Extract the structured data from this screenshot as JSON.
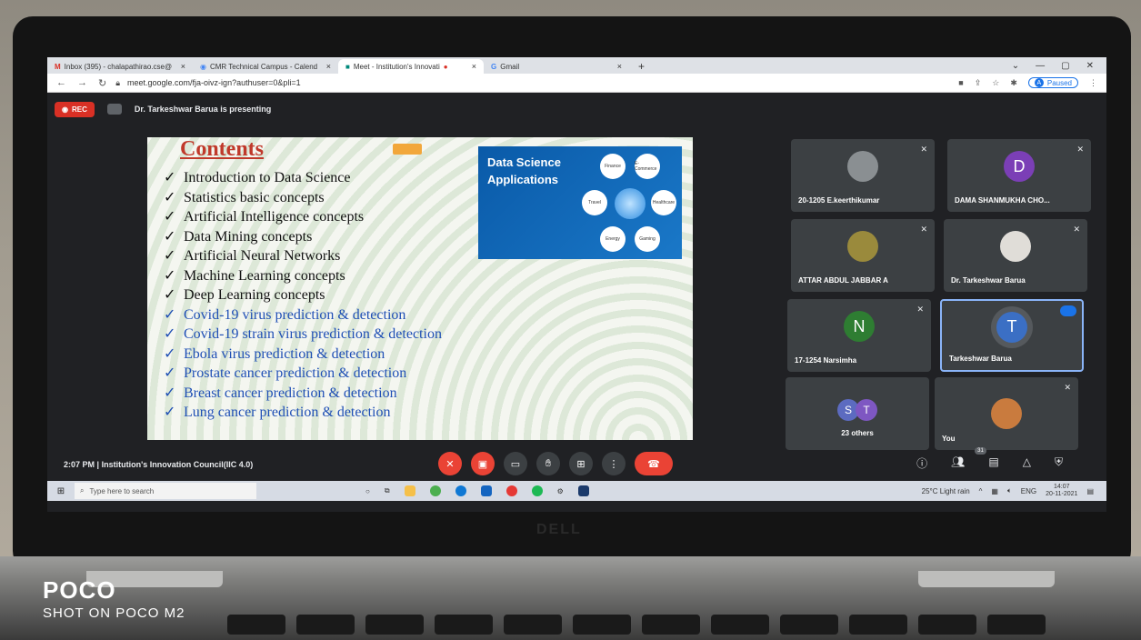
{
  "browser": {
    "tabs": [
      {
        "label": "Inbox (395) - chalapathirao.cse@",
        "icon": "gmail-icon"
      },
      {
        "label": "CMR Technical Campus - Calend",
        "icon": "chrome-icon"
      },
      {
        "label": "Meet - Institution's Innovati",
        "icon": "meet-icon"
      },
      {
        "label": "Gmail",
        "icon": "google-icon"
      }
    ],
    "new_tab": "+",
    "url": "meet.google.com/fja-oivz-ign?authuser=0&pli=1",
    "profile_initial": "A",
    "profile_status": "Paused"
  },
  "meet": {
    "rec_label": "REC",
    "presenting_text": "Dr. Tarkeshwar Barua is presenting",
    "time": "2:07 PM",
    "separator": "|",
    "meeting_name": "Institution's Innovation Council(IIC 4.0)",
    "participants_count": "31"
  },
  "slide": {
    "title": "Contents",
    "items": [
      {
        "text": "Introduction to Data Science",
        "color": "#111111"
      },
      {
        "text": "Statistics basic concepts",
        "color": "#111111"
      },
      {
        "text": "Artificial Intelligence concepts",
        "color": "#111111"
      },
      {
        "text": "Data Mining concepts",
        "color": "#111111"
      },
      {
        "text": "Artificial Neural Networks",
        "color": "#111111"
      },
      {
        "text": "Machine Learning concepts",
        "color": "#111111"
      },
      {
        "text": "Deep Learning concepts",
        "color": "#111111"
      },
      {
        "text": "Covid-19 virus prediction & detection",
        "color": "#1f4fb5"
      },
      {
        "text": "Covid-19 strain virus prediction & detection",
        "color": "#1f4fb5"
      },
      {
        "text": "Ebola virus prediction & detection",
        "color": "#1f4fb5"
      },
      {
        "text": "Prostate cancer prediction & detection",
        "color": "#1f4fb5"
      },
      {
        "text": "Breast cancer prediction & detection",
        "color": "#1f4fb5"
      },
      {
        "text": "Lung cancer prediction & detection",
        "color": "#1f4fb5"
      }
    ],
    "check": "✓",
    "apps_image_title_line1": "Data Science",
    "apps_image_title_line2": "Applications",
    "apps_hex_labels": [
      "Finance",
      "E-Commerce",
      "Healthcare",
      "Gaming",
      "Energy",
      "Travel"
    ]
  },
  "participants": [
    {
      "name": "20-1205 E.keerthikumar",
      "avatar": "photo",
      "muted": true
    },
    {
      "name": "DAMA SHANMUKHA CHO...",
      "avatar": "D",
      "avatar_color": "#7b3fb6",
      "muted": true
    },
    {
      "name": "ATTAR ABDUL JABBAR A",
      "avatar": "photo",
      "muted": true
    },
    {
      "name": "Dr. Tarkeshwar Barua",
      "avatar": "photo",
      "muted": true
    },
    {
      "name": "17-1254 Narsimha",
      "avatar": "N",
      "avatar_color": "#2e7d32",
      "muted": true
    },
    {
      "name": "Tarkeshwar Barua",
      "avatar": "T",
      "avatar_color": "#3b6fc4",
      "speaking": true
    },
    {
      "name": "23 others",
      "avatar_letters": [
        "S",
        "T"
      ],
      "avatar_colors": [
        "#5c6bc0",
        "#7e57c2"
      ]
    },
    {
      "name": "You",
      "avatar": "photo",
      "muted": true
    }
  ],
  "taskbar": {
    "search_placeholder": "Type here to search",
    "weather": "25°C  Light rain",
    "language": "ENG",
    "clock_time": "14:07",
    "clock_date": "20-11-2021"
  },
  "photo_overlay": {
    "brand": "POCO",
    "shot_on": "SHOT ON POCO M2",
    "laptop_logo": "DELL"
  },
  "colors": {
    "meet_bg": "#202124",
    "tile_bg": "#3c4043",
    "danger_red": "#ea4335",
    "accent_blue": "#1a73e8"
  }
}
